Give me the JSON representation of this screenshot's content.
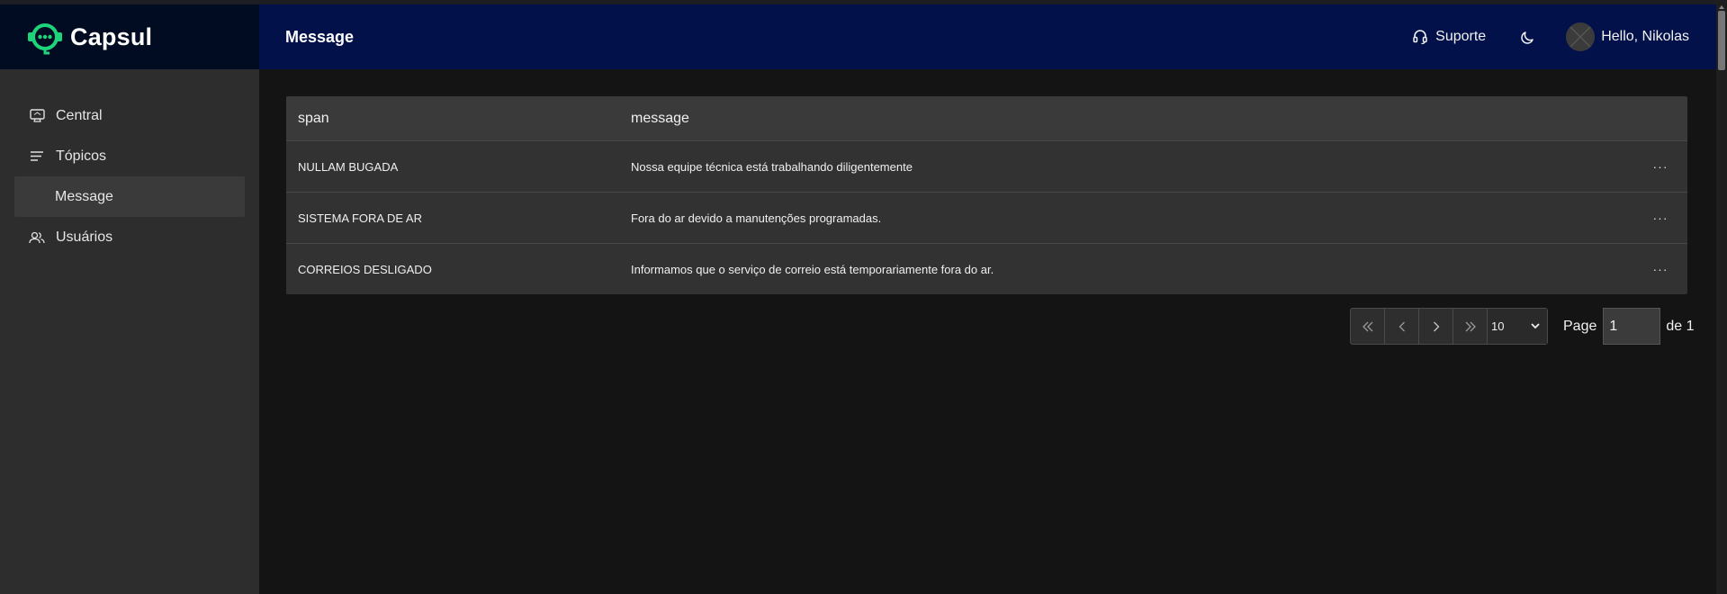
{
  "app": {
    "name": "Capsul"
  },
  "header": {
    "page_title": "Message",
    "support_label": "Suporte",
    "greeting": "Hello, Nikolas"
  },
  "sidebar": {
    "items": [
      {
        "label": "Central",
        "icon": "monitor-icon"
      },
      {
        "label": "Tópicos",
        "icon": "list-icon"
      },
      {
        "label": "Message",
        "icon": "",
        "active": true
      },
      {
        "label": "Usuários",
        "icon": "users-icon"
      }
    ]
  },
  "table": {
    "columns": [
      "span",
      "message"
    ],
    "rows": [
      {
        "span": "NULLAM BUGADA",
        "message": "Nossa equipe técnica está trabalhando diligentemente",
        "actions": "···"
      },
      {
        "span": "SISTEMA FORA DE AR",
        "message": "Fora do ar devido a manutenções programadas.",
        "actions": "···"
      },
      {
        "span": "CORREIOS DESLIGADO",
        "message": "Informamos que o serviço de correio está temporariamente fora do ar.",
        "actions": "···"
      }
    ]
  },
  "pagination": {
    "page_size": "10",
    "page_label": "Page",
    "current_page": "1",
    "total_label": "de 1"
  },
  "colors": {
    "accent": "#1ed47a",
    "topbar": "#03114b",
    "sidebar_header": "#010b22",
    "sidebar": "#2d2d2d",
    "background": "#141414"
  }
}
